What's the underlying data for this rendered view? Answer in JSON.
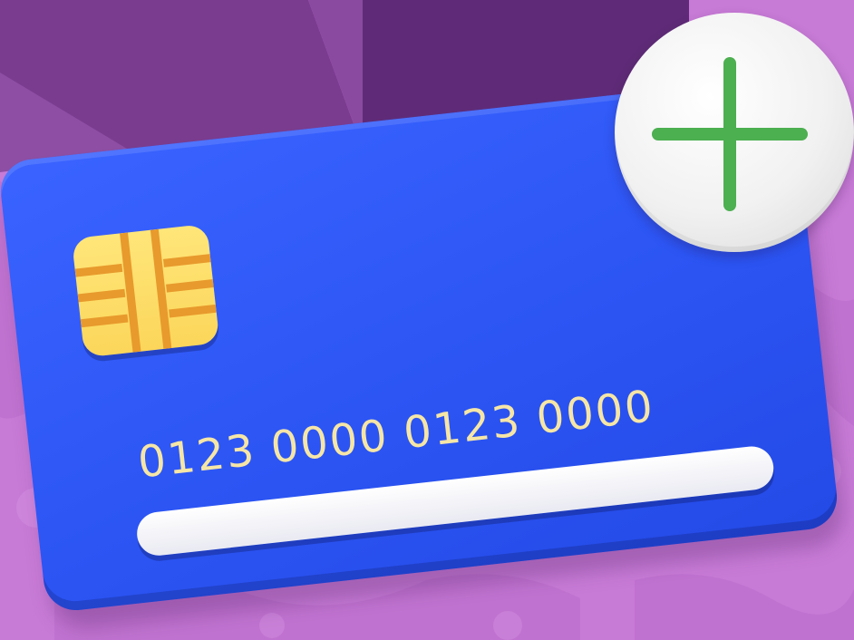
{
  "card": {
    "number": "0123 0000 0123 0000"
  },
  "icons": {
    "chip": "card-chip-icon",
    "add": "plus-icon"
  },
  "colors": {
    "background": "#c77ad6",
    "card": "#2c55f4",
    "chip": "#fbd65a",
    "number": "#f6e6a6",
    "plus": "#4caf50"
  }
}
